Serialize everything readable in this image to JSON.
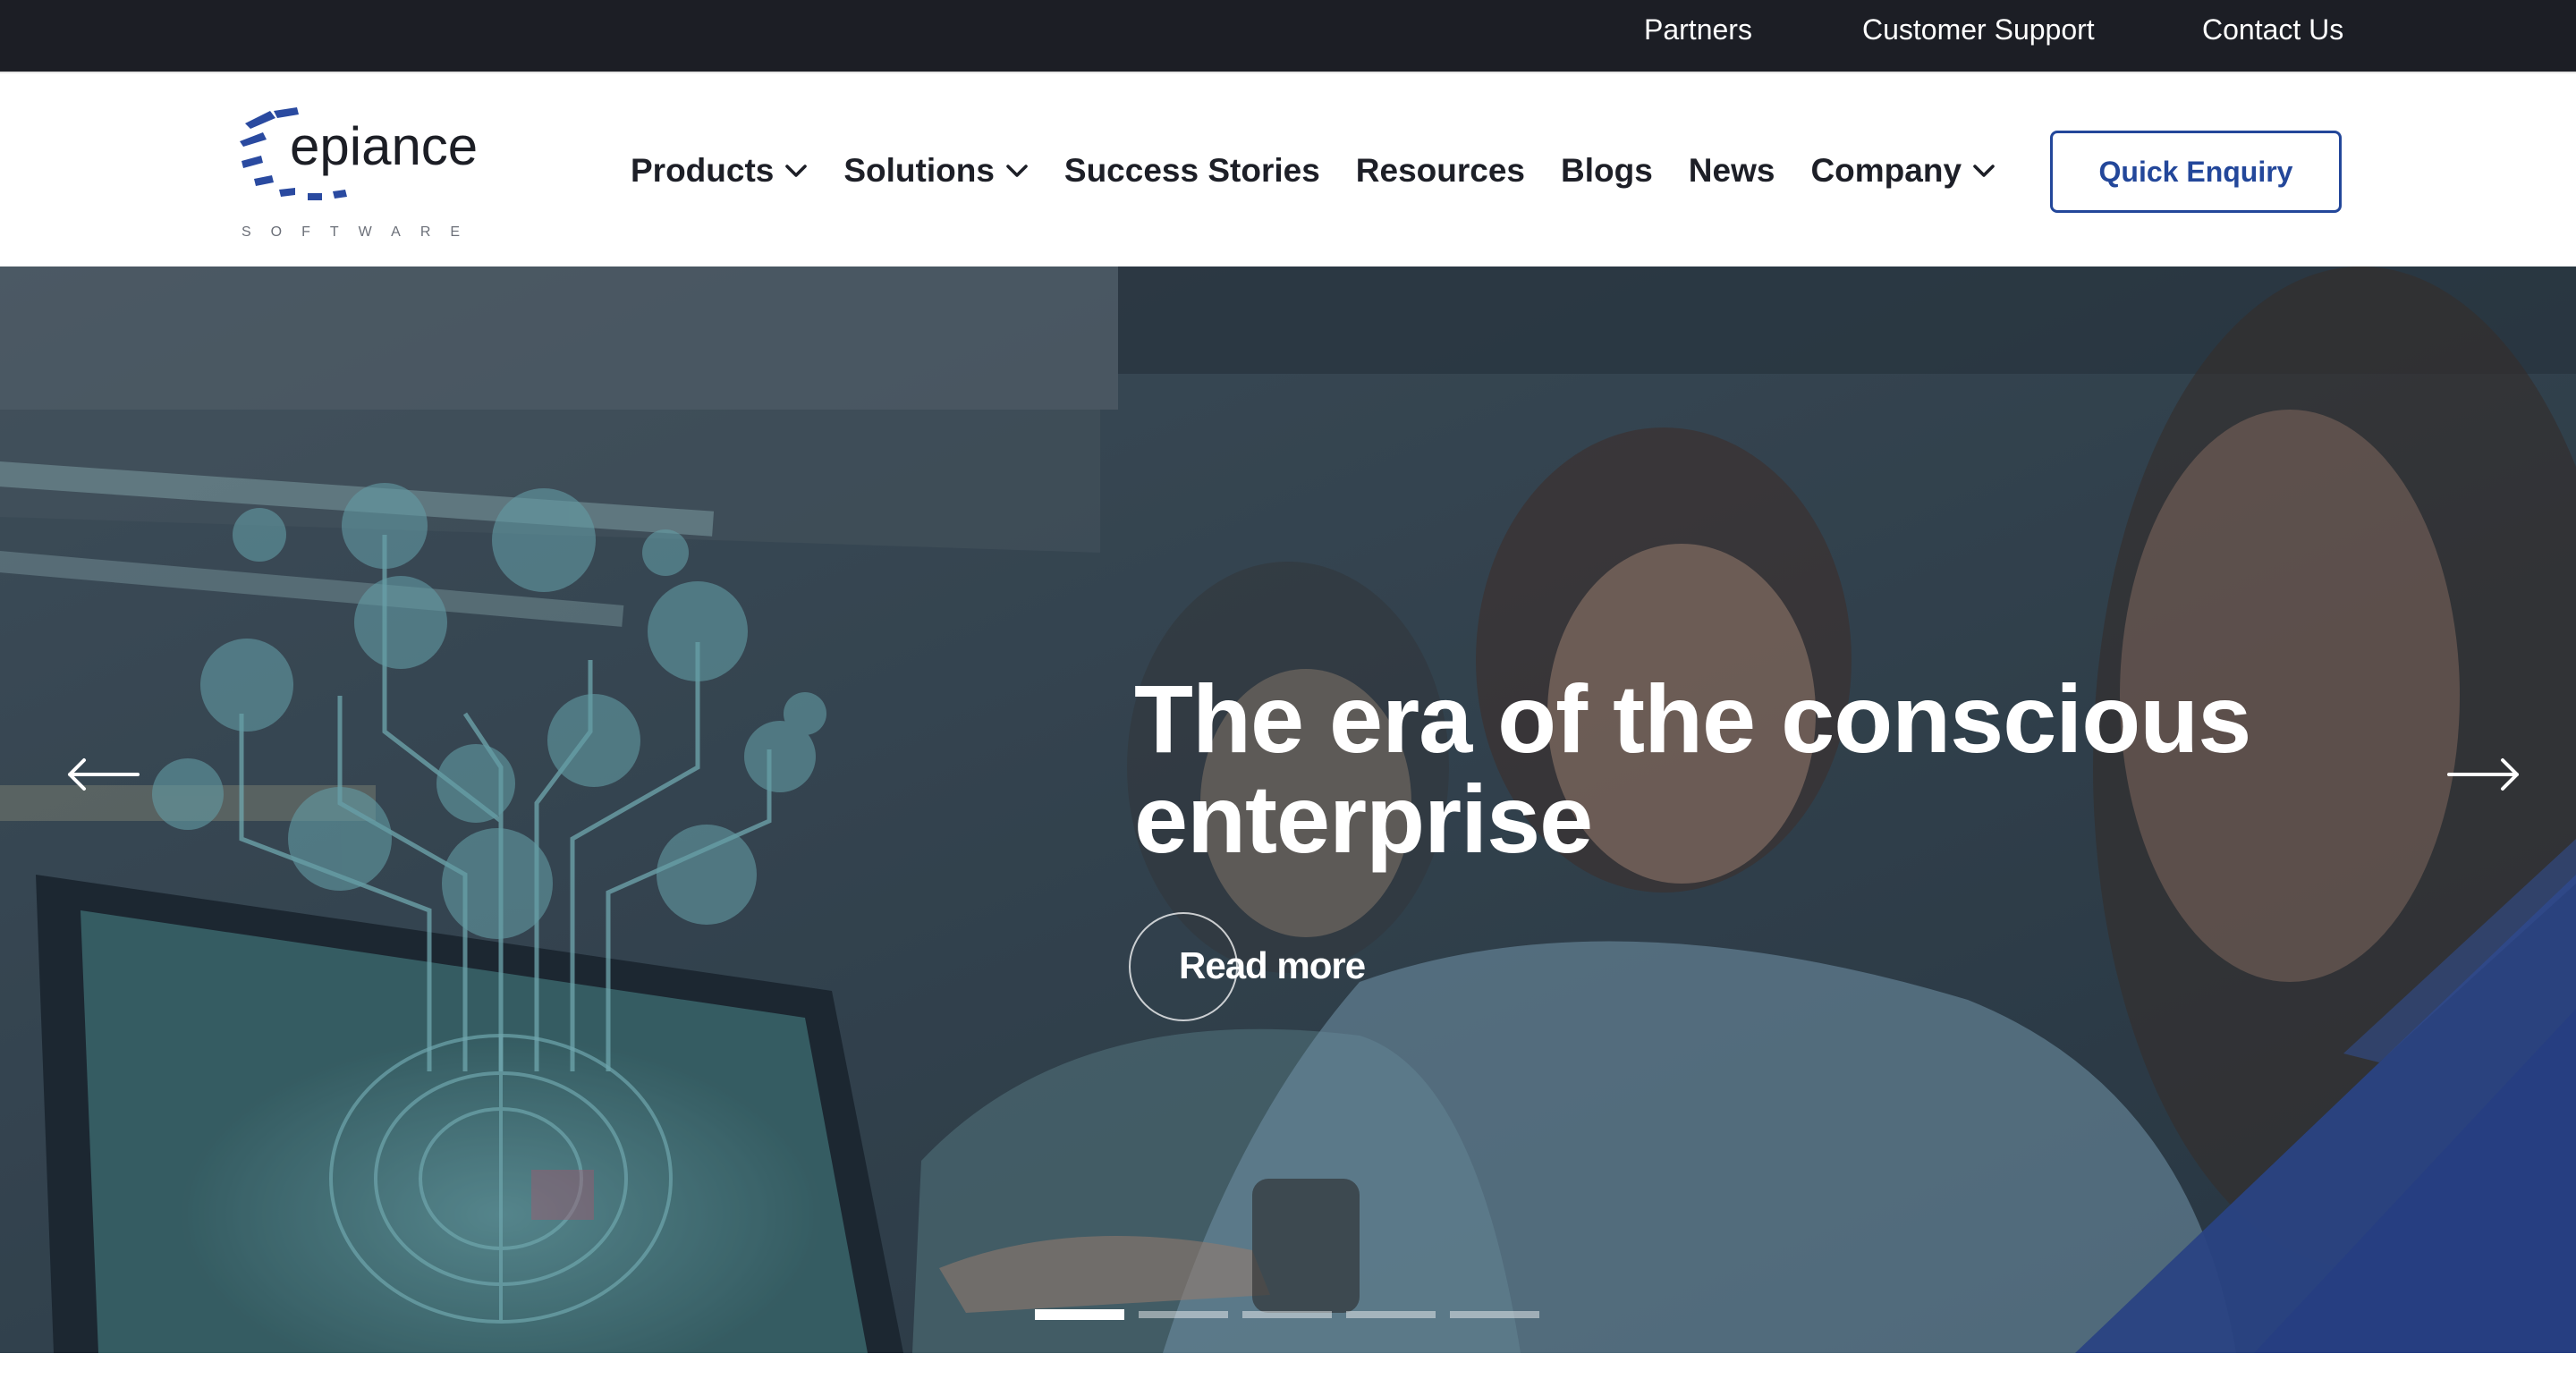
{
  "topbar": {
    "links": [
      "Partners",
      "Customer Support",
      "Contact Us"
    ]
  },
  "logo": {
    "wordmark": "epiance",
    "tagline": "SOFTWARE"
  },
  "nav": {
    "items": [
      {
        "label": "Products",
        "dropdown": true
      },
      {
        "label": "Solutions",
        "dropdown": true
      },
      {
        "label": "Success Stories",
        "dropdown": false
      },
      {
        "label": "Resources",
        "dropdown": false
      },
      {
        "label": "Blogs",
        "dropdown": false
      },
      {
        "label": "News",
        "dropdown": false
      },
      {
        "label": "Company",
        "dropdown": true
      }
    ],
    "cta_label": "Quick Enquiry"
  },
  "hero": {
    "title": "The era of the conscious enterprise",
    "cta_label": "Read more",
    "slide_count": 5,
    "active_slide": 1
  },
  "colors": {
    "topbar_bg": "#1c1e25",
    "brand_blue": "#23479a",
    "hero_overlay": "#3b4b58"
  },
  "icons": [
    "chevron-down-icon",
    "arrow-left-icon",
    "arrow-right-icon"
  ]
}
